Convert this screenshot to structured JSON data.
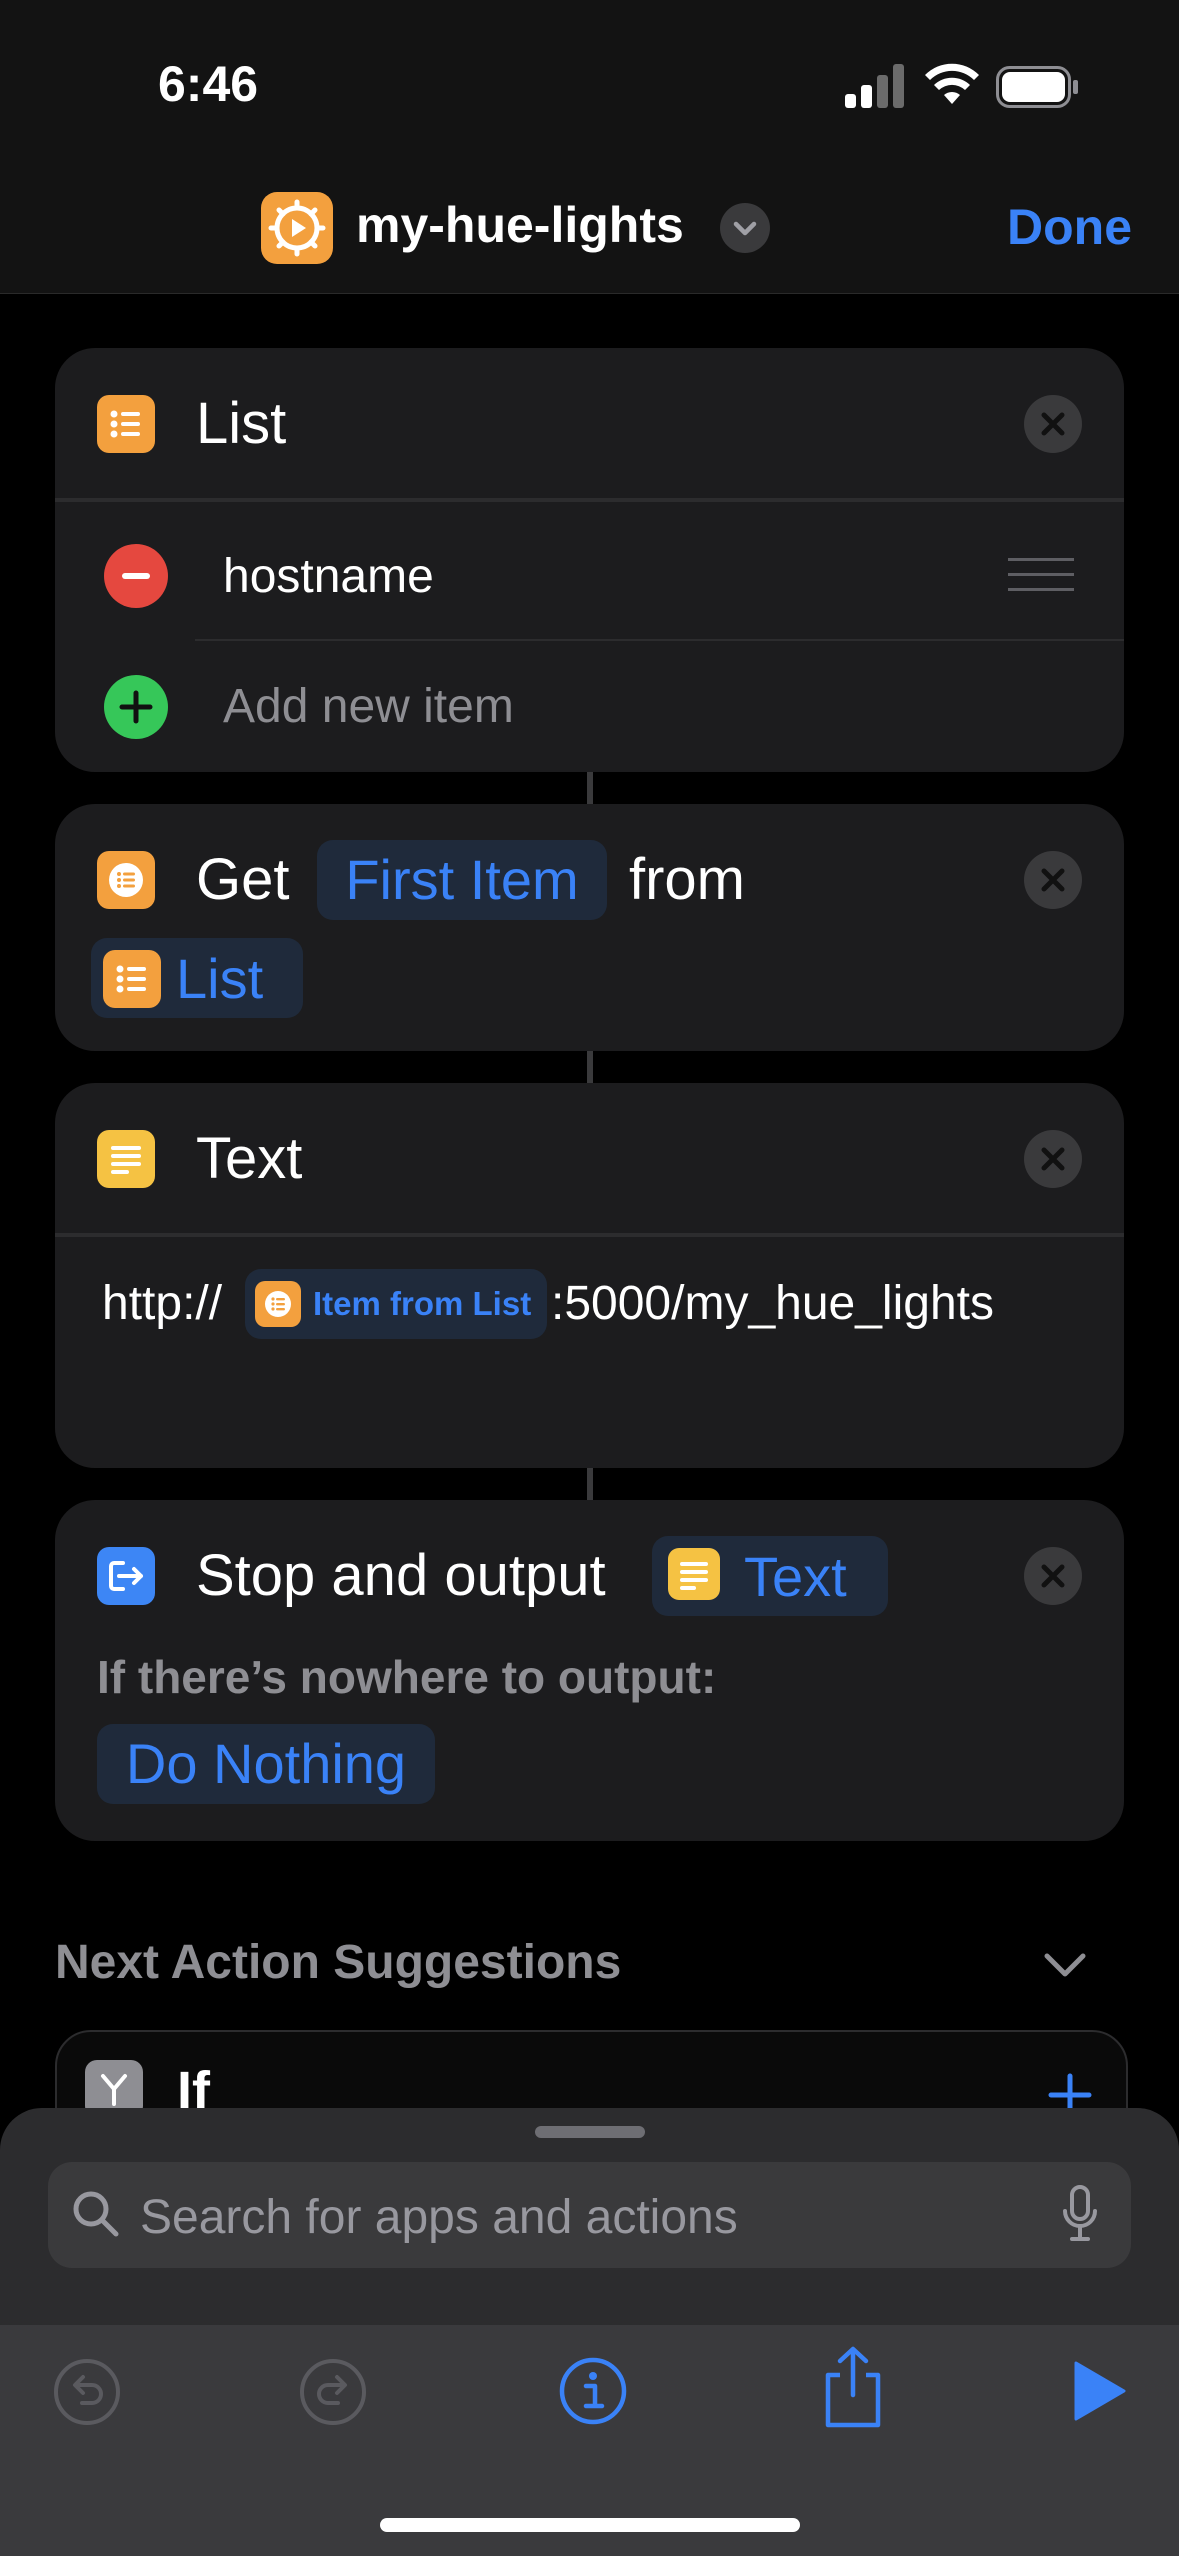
{
  "status_bar": {
    "time": "6:46"
  },
  "nav": {
    "title": "my-hue-lights",
    "done": "Done"
  },
  "list_card": {
    "title": "List",
    "items": [
      "hostname"
    ],
    "add_placeholder": "Add new item"
  },
  "get_card": {
    "get": "Get",
    "param": "First Item",
    "from": "from",
    "source": "List"
  },
  "text_card": {
    "title": "Text",
    "prefix": "http://",
    "variable": "Item from List",
    "suffix": ":5000/my_hue_lights"
  },
  "stop_card": {
    "title": "Stop and output",
    "param": "Text",
    "subtitle": "If there’s nowhere to output:",
    "action": "Do Nothing"
  },
  "suggestions": {
    "title": "Next Action Suggestions",
    "first_item": "If"
  },
  "search": {
    "placeholder": "Search for apps and actions"
  },
  "colors": {
    "accent": "#3a82f7",
    "orange": "#f3a03e",
    "yellow": "#f5c243",
    "remove": "#e5483f",
    "add": "#36c759"
  }
}
